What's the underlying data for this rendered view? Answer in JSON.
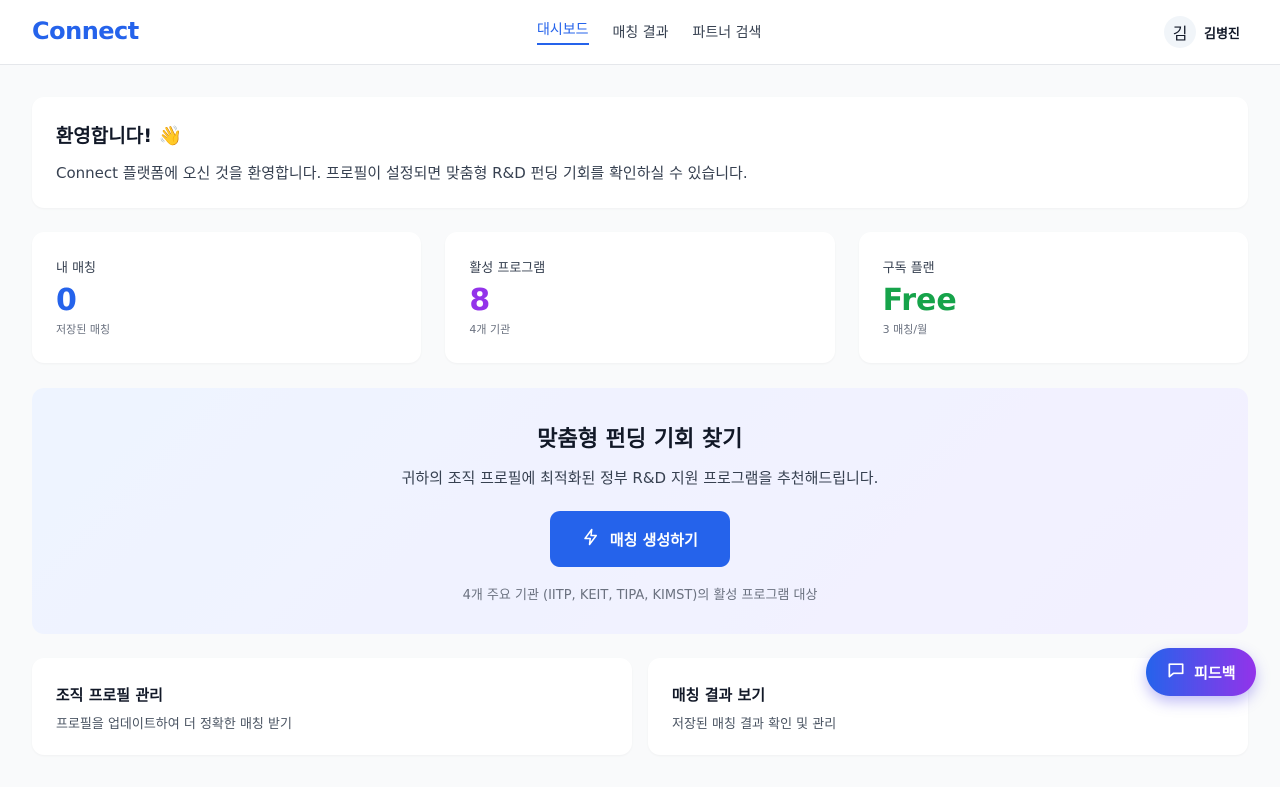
{
  "app": {
    "logo": "Connect"
  },
  "nav": {
    "tabs": [
      {
        "label": "대시보드"
      },
      {
        "label": "매칭 결과"
      },
      {
        "label": "파트너 검색"
      }
    ]
  },
  "user": {
    "avatar_initial": "김",
    "name": "김병진"
  },
  "welcome": {
    "title": "환영합니다! 👋",
    "message": "Connect 플랫폼에 오신 것을 환영합니다. 프로필이 설정되면 맞춤형 R&D 펀딩 기회를 확인하실 수 있습니다."
  },
  "stats": [
    {
      "label": "내 매칭",
      "value": "0",
      "sub": "저장된 매칭",
      "color": "#2563eb"
    },
    {
      "label": "활성 프로그램",
      "value": "8",
      "sub": "4개 기관",
      "color": "#9333ea"
    },
    {
      "label": "구독 플랜",
      "value": "Free",
      "sub": "3 매칭/월",
      "color": "#16a34a"
    }
  ],
  "hero": {
    "title": "맞춤형 펀딩 기회 찾기",
    "description": "귀하의 조직 프로필에 최적화된 정부 R&D 지원 프로그램을 추천해드립니다.",
    "button_label": "매칭 생성하기",
    "button_icon": "lightning-icon",
    "note": "4개 주요 기관 (IITP, KEIT, TIPA, KIMST)의 활성 프로그램 대상"
  },
  "cards": [
    {
      "title": "조직 프로필 관리",
      "description": "프로필을 업데이트하여 더 정확한 매칭 받기"
    },
    {
      "title": "매칭 결과 보기",
      "description": "저장된 매칭 결과 확인 및 관리"
    }
  ],
  "feedback": {
    "label": "피드백",
    "icon": "chat-icon"
  },
  "colors": {
    "accent": "#2563eb",
    "purple": "#9333ea",
    "green": "#16a34a"
  }
}
